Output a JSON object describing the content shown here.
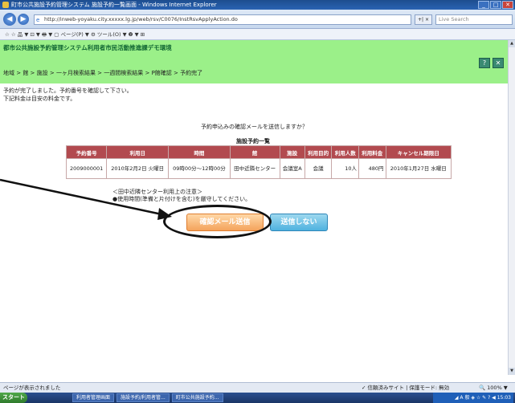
{
  "window": {
    "title": "町市公共施設予約管理システム 施設予約一覧画面 - Windows Internet Explorer"
  },
  "browser": {
    "url": "http://inweb-yoyaku.city.xxxxx.lg.jp/web/rsv/C0076/InstRsvApplyAction.do",
    "search_placeholder": "Live Search",
    "refresh_label": "+| ×",
    "toolbar_text": "☆ ☆  品 ▼ ⊡ ▼ 🖶 ▼ ▢ ページ(P) ▼ ⚙ ツール(O) ▼ ❷ ▼ ⊞"
  },
  "site": {
    "title": "都市公共施設予約管理システム利用者市民活動推進課デモ環境",
    "header_icons": [
      "?",
      "✕"
    ],
    "breadcrumb": "地域 > 館 > 施設 > 一ヶ月検索結果 > 一週間検索結果 > P館確認 > 予約完了"
  },
  "main": {
    "message_line1": "予約が完了しました。予約番号を確認して下さい。",
    "message_line2": "下記料金は目安の料金です。",
    "confirm_question": "予約申込みの確認メールを送信しますか？",
    "table_title": "施設予約一覧",
    "table": {
      "headers": [
        "予約番号",
        "利用日",
        "時間",
        "館",
        "施設",
        "利用目的",
        "利用人数",
        "利用料金",
        "キャンセル期限日"
      ],
      "rows": [
        [
          "2009000001",
          "2010年2月2日 火曜日",
          "09時00分〜12時00分",
          "田中近隣センター",
          "会議室A",
          "会議",
          "10人",
          "480円",
          "2010年1月27日 水曜日"
        ]
      ]
    },
    "note_line1": "＜田中近隣センター利用上の注意＞",
    "note_line2": "●使用時間(準備と片付けを含む)を厳守してください。",
    "send_button": "確認メール送信",
    "no_send_button": "送信しない"
  },
  "statusbar": {
    "left": "ページが表示されました",
    "mid": "✓ 信頼済みサイト | 保護モード: 無効",
    "zoom": "🔍 100% ▼"
  },
  "taskbar": {
    "start": "スタート",
    "tasks": [
      "利用者管理画面",
      "施設予約/利用者管...",
      "町市公共施設予約..."
    ],
    "tray": "◢ A 般 ◈ ☆ ✎ ? ◀ 15:03"
  }
}
